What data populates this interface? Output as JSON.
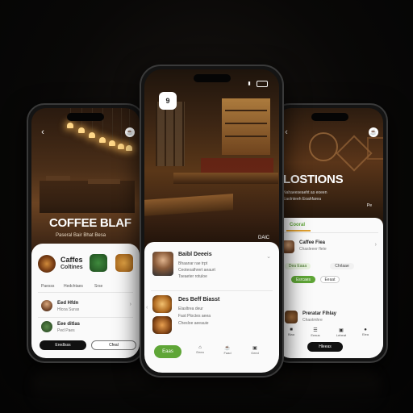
{
  "left_phone": {
    "hero_title": "COFFEE BLAF",
    "hero_subtitle": "Paseral Bair Bhat Besa",
    "featured_title": "Caffes",
    "featured_subtitle": "Coltines",
    "tabs": [
      "Paesss",
      "Hedchtaes",
      "Srse"
    ],
    "list": [
      {
        "title": "Eed Hfdn",
        "subtitle": "Hlcoa Suras"
      },
      {
        "title": "Eee ditlas",
        "subtitle": "Ped Paes"
      }
    ],
    "primary_button": "Eredlsss",
    "secondary_button": "Cfeal"
  },
  "center_phone": {
    "status_badge": "9",
    "corner_label": "DAlC",
    "card1": {
      "title": "Baibl Deeeis",
      "lines": [
        "Bhaanar rae trpt",
        "Ceoteoalhrert aeaurt",
        "Tseaeter rotuloe"
      ]
    },
    "card2": {
      "title": "Des Beff Biasst",
      "lines": [
        "Elasltrea deur",
        "Fast Ploctes aeea",
        "Chesloe aeeauie"
      ]
    },
    "nav": {
      "active": "Eaas",
      "items": [
        "Eeea",
        "Faad",
        "Geed"
      ]
    }
  },
  "right_phone": {
    "hero_title": "LOSTIONS",
    "hero_subtitle": "Nahaeeseaeht as eoeen",
    "hero_sub2": "Eaolnteeh Eoahfarea",
    "hero_badge": "Pe",
    "tab_active": "Cooral",
    "list1": {
      "title": "Caffee Fiea",
      "subtitle": "Chasleeer flete"
    },
    "chips": [
      "Dea Eaaa",
      "Chrlaae"
    ],
    "green_pill": "Esrcaes",
    "pill2": "Eeaat",
    "list2": {
      "title": "Preratar Flhlay",
      "subtitle": "Chaotmhre"
    },
    "nav": [
      "Biaa",
      "Eeaus",
      "Lebeat",
      "Eiea"
    ],
    "primary_button": "Hleeas"
  },
  "colors": {
    "accent_green": "#5fa637",
    "card_bg": "#fafafa",
    "dark": "#111111"
  }
}
